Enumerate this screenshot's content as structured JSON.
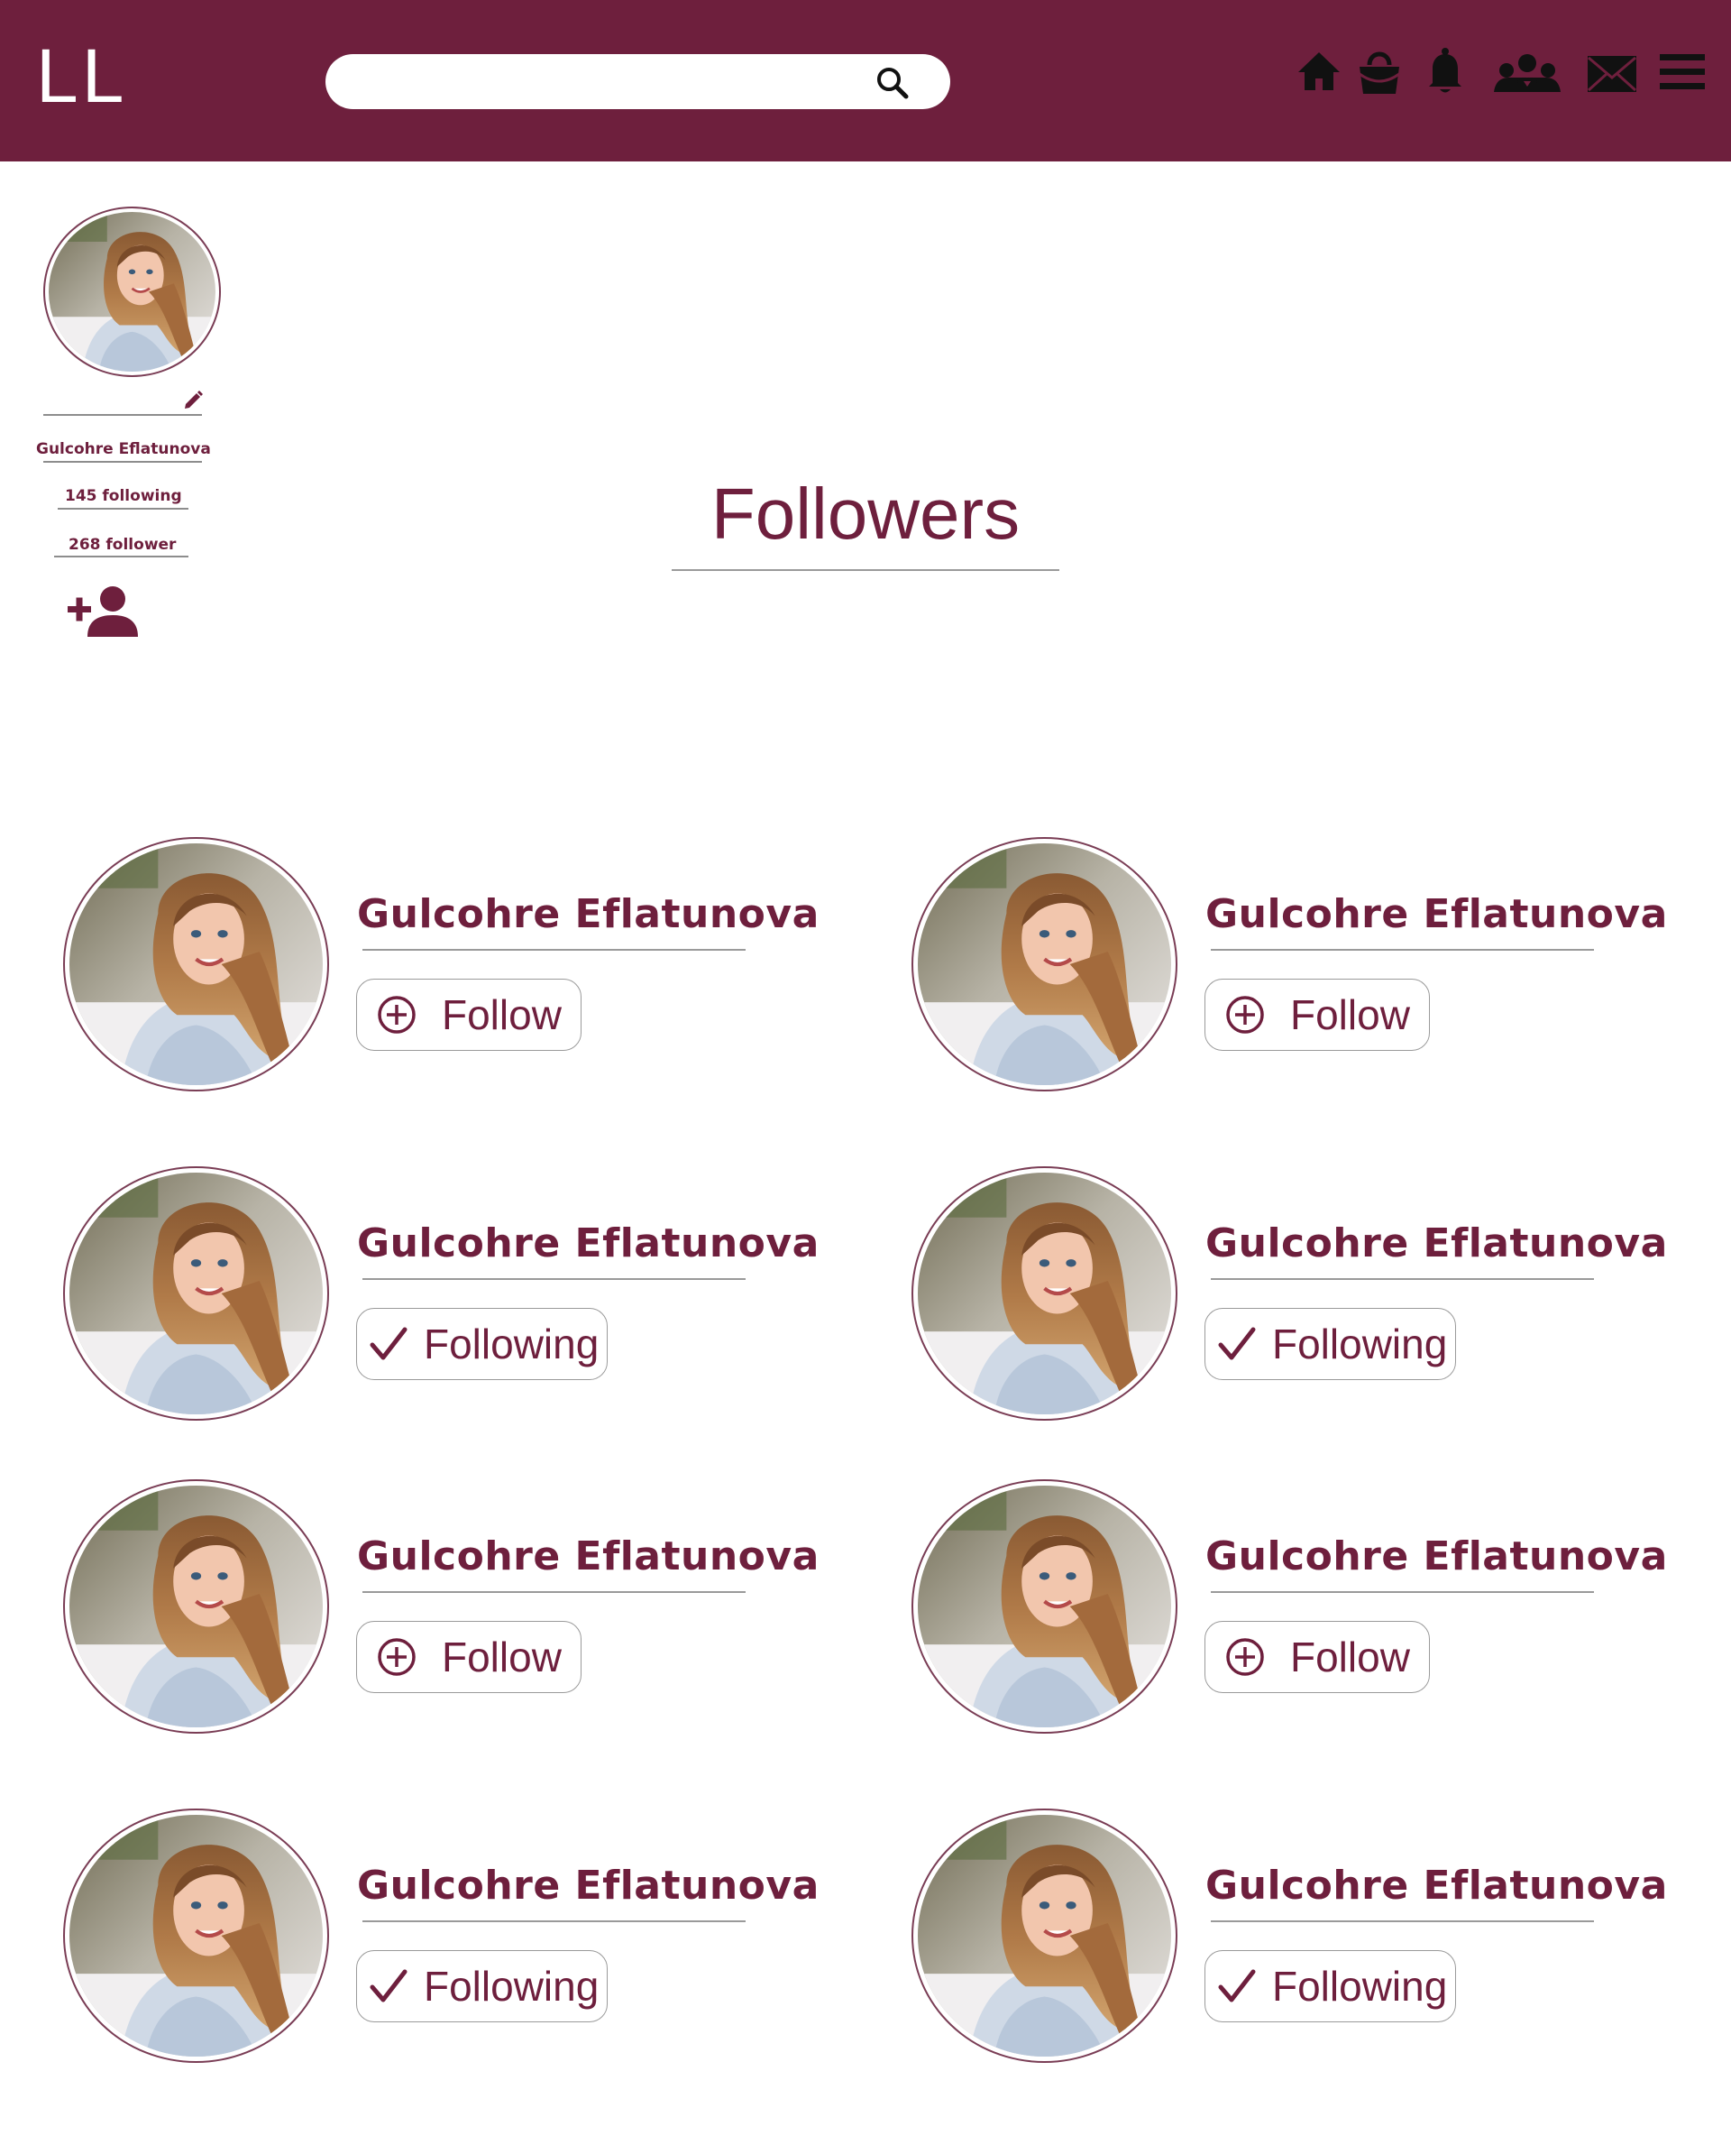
{
  "app": {
    "logo": "LL",
    "brand_color": "#6e1f3d"
  },
  "header": {
    "search": {
      "placeholder": "",
      "icon": "search-icon"
    },
    "nav_icons": [
      "home-icon",
      "shopping-bag-icon",
      "bell-icon",
      "community-icon",
      "mail-icon",
      "menu-icon"
    ]
  },
  "profile": {
    "name": "Gulcohre Eflatunova",
    "following": "145 following",
    "followers": "268 follower",
    "edit_icon": "pencil-icon",
    "add_friend_icon": "add-user-icon"
  },
  "page": {
    "title": "Followers"
  },
  "followers": [
    {
      "name": "Gulcohre Eflatunova",
      "status": "follow",
      "button_label": "Follow"
    },
    {
      "name": "Gulcohre Eflatunova",
      "status": "follow",
      "button_label": "Follow"
    },
    {
      "name": "Gulcohre Eflatunova",
      "status": "following",
      "button_label": "Following"
    },
    {
      "name": "Gulcohre Eflatunova",
      "status": "following",
      "button_label": "Following"
    },
    {
      "name": "Gulcohre Eflatunova",
      "status": "follow",
      "button_label": "Follow"
    },
    {
      "name": "Gulcohre Eflatunova",
      "status": "follow",
      "button_label": "Follow"
    },
    {
      "name": "Gulcohre Eflatunova",
      "status": "following",
      "button_label": "Following"
    },
    {
      "name": "Gulcohre Eflatunova",
      "status": "following",
      "button_label": "Following"
    }
  ]
}
